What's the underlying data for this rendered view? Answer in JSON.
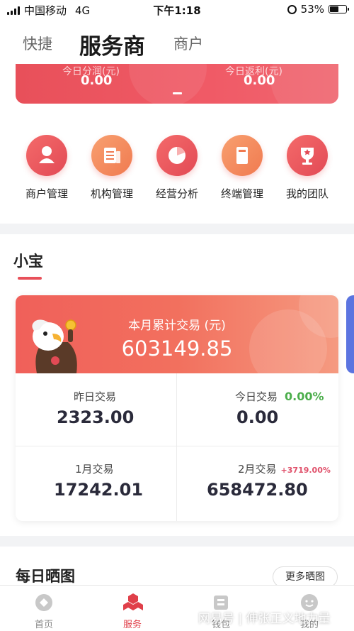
{
  "status_bar": {
    "carrier": "中国移动",
    "network": "4G",
    "time": "下午1:18",
    "battery": "53%",
    "battery_level": 0.53
  },
  "header": {
    "tabs": [
      "快捷",
      "服务商",
      "商户"
    ],
    "active_tab": "服务商"
  },
  "banner": {
    "left_label": "今日分润(元)",
    "left_value": "0.00",
    "right_label": "今日返利(元)",
    "right_value": "0.00"
  },
  "menu": [
    {
      "label": "商户管理",
      "icon": "merchant-icon"
    },
    {
      "label": "机构管理",
      "icon": "institution-icon"
    },
    {
      "label": "经营分析",
      "icon": "pie-chart-icon"
    },
    {
      "label": "终端管理",
      "icon": "terminal-icon"
    },
    {
      "label": "我的团队",
      "icon": "trophy-icon"
    }
  ],
  "section": {
    "title": "小宝"
  },
  "card": {
    "title": "本月累计交易 (元)",
    "total": "603149.85",
    "cells": [
      {
        "label": "昨日交易",
        "value": "2323.00",
        "change": ""
      },
      {
        "label": "今日交易",
        "value": "0.00",
        "change": "0.00%"
      },
      {
        "label": "1月交易",
        "value": "17242.01",
        "change": ""
      },
      {
        "label": "2月交易",
        "value": "658472.80",
        "change": "+3719.00%"
      }
    ]
  },
  "daily": {
    "title": "每日晒图",
    "more_button": "更多晒图"
  },
  "tabbar": [
    {
      "label": "首页",
      "icon": "home-icon"
    },
    {
      "label": "服务",
      "icon": "service-icon"
    },
    {
      "label": "钱包",
      "icon": "wallet-icon"
    },
    {
      "label": "我的",
      "icon": "profile-icon"
    }
  ],
  "tabbar_active": "服务",
  "watermark": "网易号 | 伸张正义地力量",
  "colors": {
    "accent": "#e8505a",
    "green": "#4cae4c",
    "pink": "#e0506a"
  }
}
